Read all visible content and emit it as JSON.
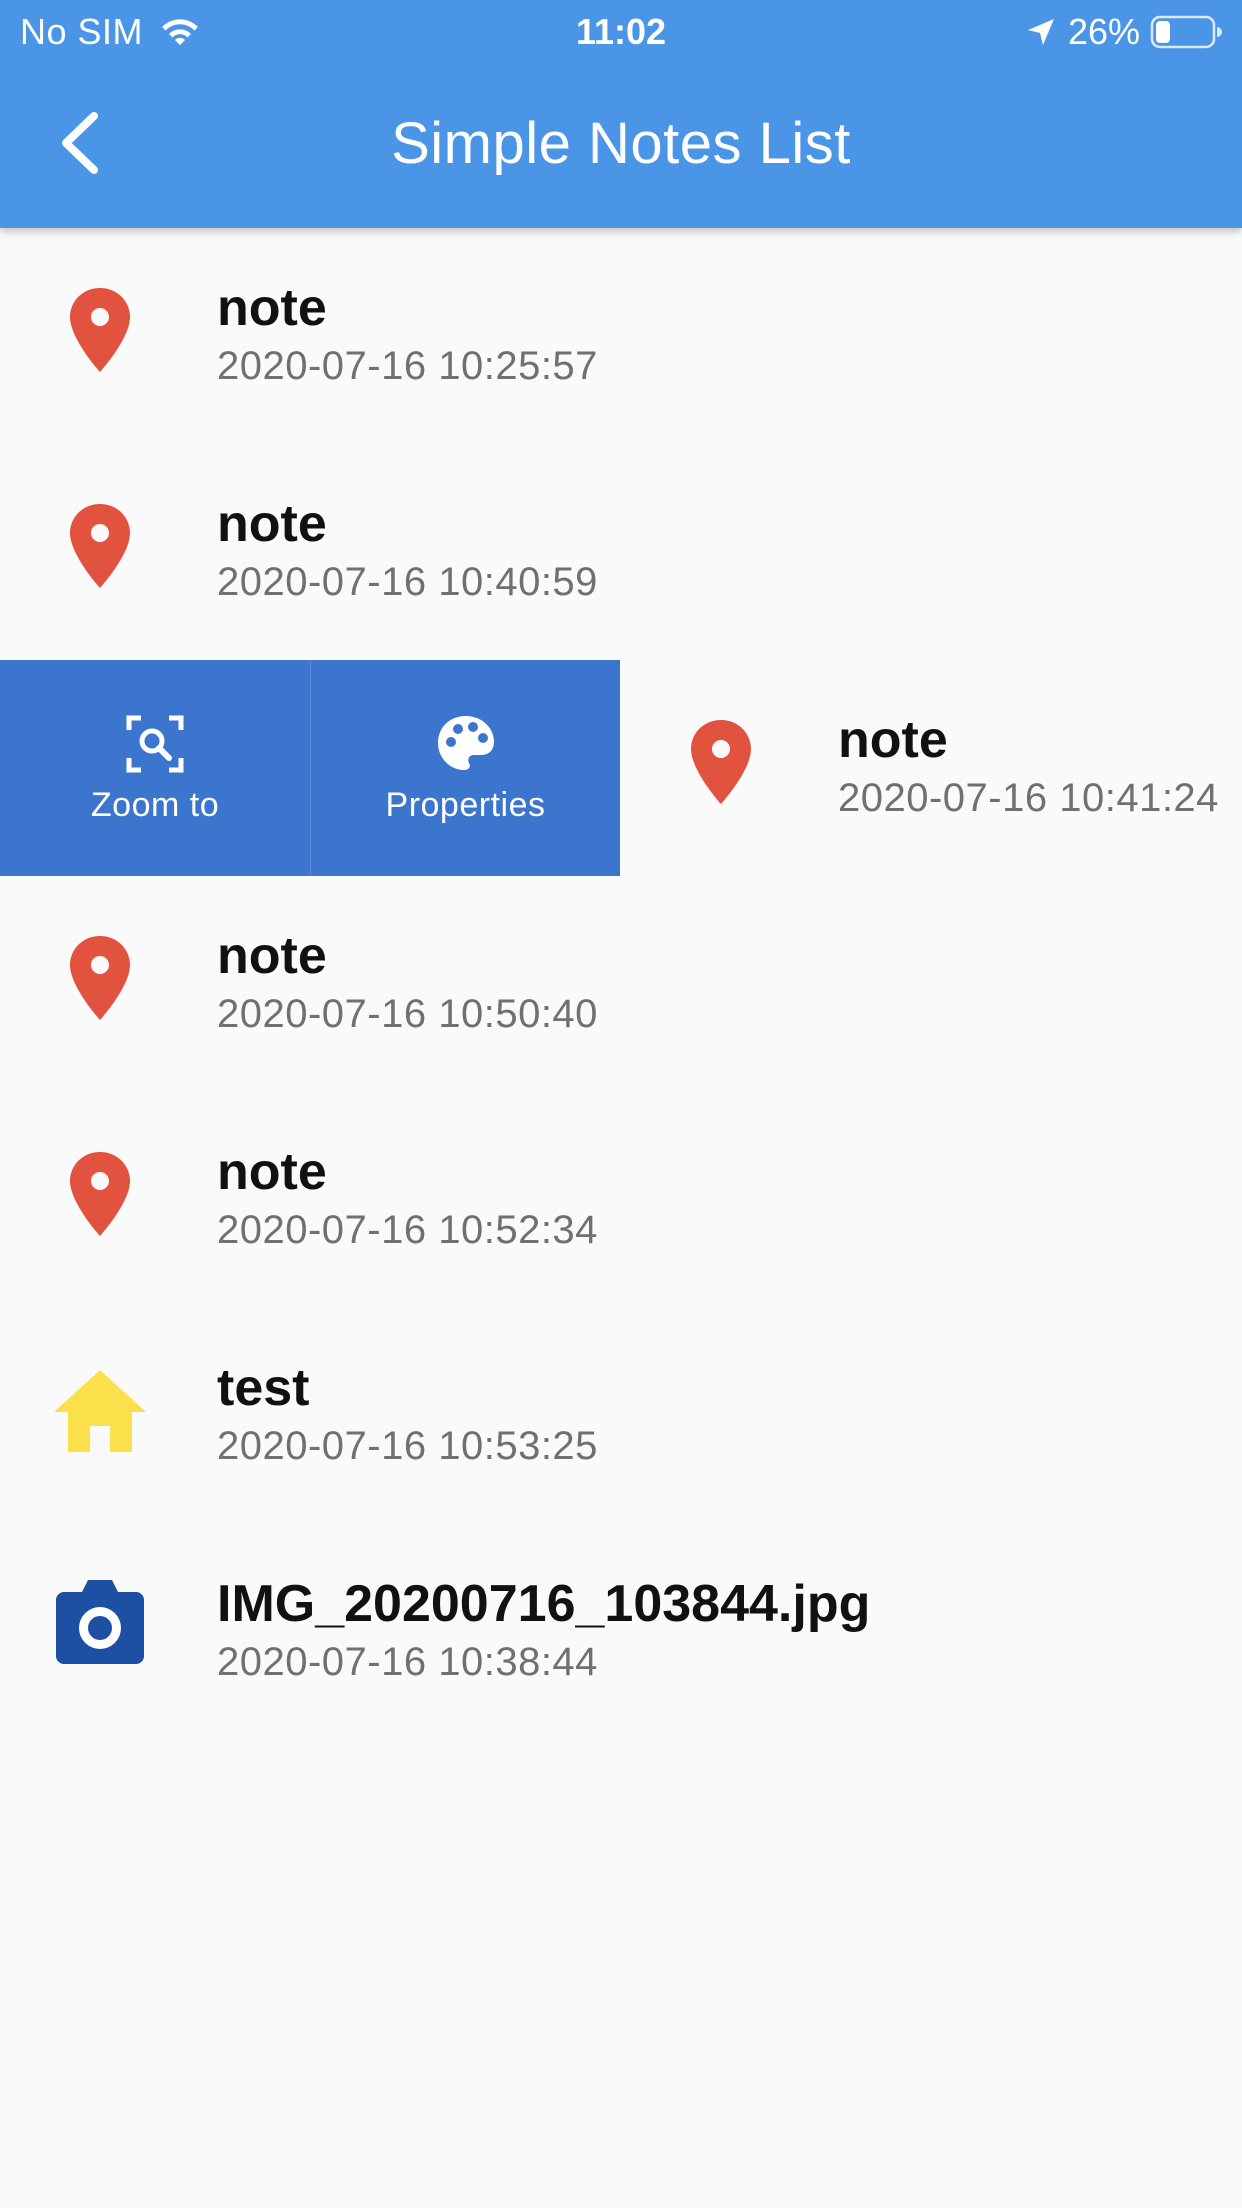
{
  "status_bar": {
    "carrier": "No SIM",
    "time": "11:02",
    "battery": "26%"
  },
  "appbar": {
    "title": "Simple Notes List",
    "back_icon": "chevron-left-icon"
  },
  "swipe_actions": [
    {
      "label": "Zoom to",
      "icon": "zoom-focus-icon"
    },
    {
      "label": "Properties",
      "icon": "palette-icon"
    }
  ],
  "notes": [
    {
      "title": "note",
      "timestamp": "2020-07-16 10:25:57",
      "icon": "map-marker-icon",
      "icon_color": "#e2533f"
    },
    {
      "title": "note",
      "timestamp": "2020-07-16 10:40:59",
      "icon": "map-marker-icon",
      "icon_color": "#e2533f"
    },
    {
      "title": "note",
      "timestamp": "2020-07-16 10:41:24",
      "icon": "map-marker-icon",
      "icon_color": "#e2533f"
    },
    {
      "title": "note",
      "timestamp": "2020-07-16 10:50:40",
      "icon": "map-marker-icon",
      "icon_color": "#e2533f"
    },
    {
      "title": "note",
      "timestamp": "2020-07-16 10:52:34",
      "icon": "map-marker-icon",
      "icon_color": "#e2533f"
    },
    {
      "title": "test",
      "timestamp": "2020-07-16 10:53:25",
      "icon": "home-icon",
      "icon_color": "#fbe04b"
    },
    {
      "title": "IMG_20200716_103844.jpg",
      "timestamp": "2020-07-16 10:38:44",
      "icon": "camera-icon",
      "icon_color": "#1d4fa3"
    }
  ],
  "colors": {
    "appbar": "#4a95e6",
    "action_background": "#3c75ce",
    "background": "#fafafa"
  }
}
